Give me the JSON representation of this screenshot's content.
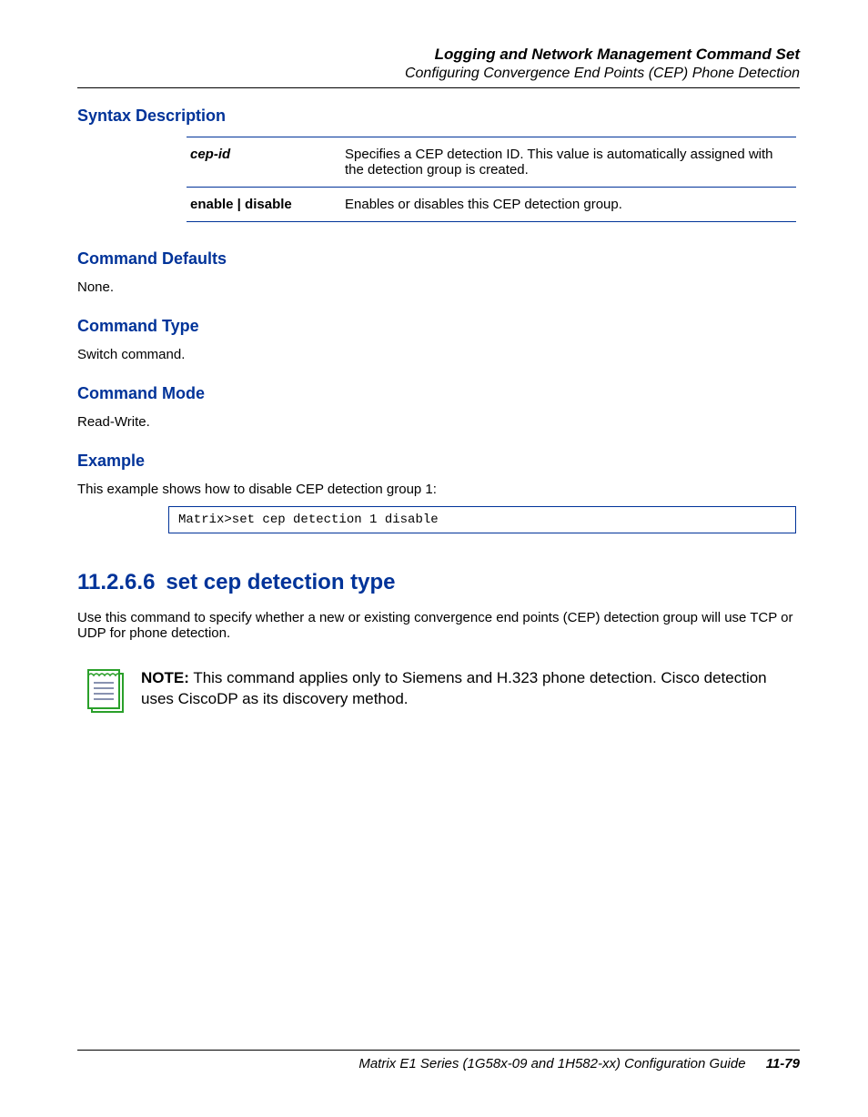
{
  "header": {
    "title": "Logging and Network Management Command Set",
    "subtitle": "Configuring Convergence End Points (CEP) Phone Detection"
  },
  "syntax": {
    "heading": "Syntax Description",
    "rows": [
      {
        "param": "cep-id",
        "param_style": "italic-bold",
        "desc": "Specifies a CEP detection ID. This value is automatically assigned with the detection group is created."
      },
      {
        "param": "enable | disable",
        "param_style": "bold",
        "desc": "Enables or disables this CEP detection group."
      }
    ]
  },
  "defaults": {
    "heading": "Command Defaults",
    "text": "None."
  },
  "type": {
    "heading": "Command Type",
    "text": "Switch command."
  },
  "mode": {
    "heading": "Command Mode",
    "text": "Read-Write."
  },
  "example": {
    "heading": "Example",
    "intro": "This example shows how to disable CEP detection group 1:",
    "code": "Matrix>set cep detection 1 disable"
  },
  "section": {
    "number": "11.2.6.6",
    "title": "set cep detection type",
    "body": "Use this command to specify whether a new or existing convergence end points (CEP) detection group will use TCP or UDP for phone detection.",
    "note_label": "NOTE:",
    "note_text": "This command applies only to Siemens and H.323 phone detection. Cisco detection uses CiscoDP as its discovery method."
  },
  "footer": {
    "guide": "Matrix E1 Series (1G58x-09 and 1H582-xx) Configuration Guide",
    "page": "11-79"
  }
}
